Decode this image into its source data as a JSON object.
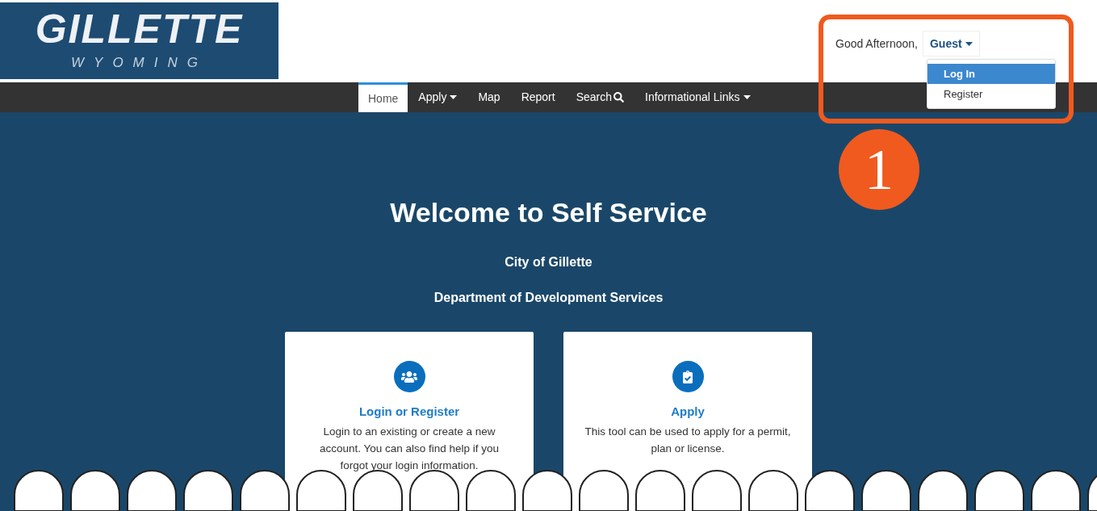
{
  "logo": {
    "title": "GILLETTE",
    "subtitle": "WYOMING"
  },
  "greeting": {
    "text": "Good Afternoon,",
    "user": "Guest",
    "menu": [
      {
        "label": "Log In",
        "selected": true
      },
      {
        "label": "Register",
        "selected": false
      }
    ]
  },
  "nav": [
    {
      "label": "Home",
      "selected": true,
      "kind": "plain"
    },
    {
      "label": "Apply",
      "selected": false,
      "kind": "caret"
    },
    {
      "label": "Map",
      "selected": false,
      "kind": "plain"
    },
    {
      "label": "Report",
      "selected": false,
      "kind": "plain"
    },
    {
      "label": "Search",
      "selected": false,
      "kind": "search"
    },
    {
      "label": "Informational Links",
      "selected": false,
      "kind": "caret"
    }
  ],
  "annotation": {
    "number": "1"
  },
  "hero": {
    "title": "Welcome to Self Service",
    "lines": [
      "City of Gillette",
      "Department of Development Services"
    ]
  },
  "cards": [
    {
      "kind": "people",
      "title": "Login or Register",
      "text": "Login to an existing or create a new account. You can also find help if you forgot your login information."
    },
    {
      "kind": "clipboard",
      "title": "Apply",
      "text": "This tool can be used to apply for a permit, plan or license."
    }
  ]
}
